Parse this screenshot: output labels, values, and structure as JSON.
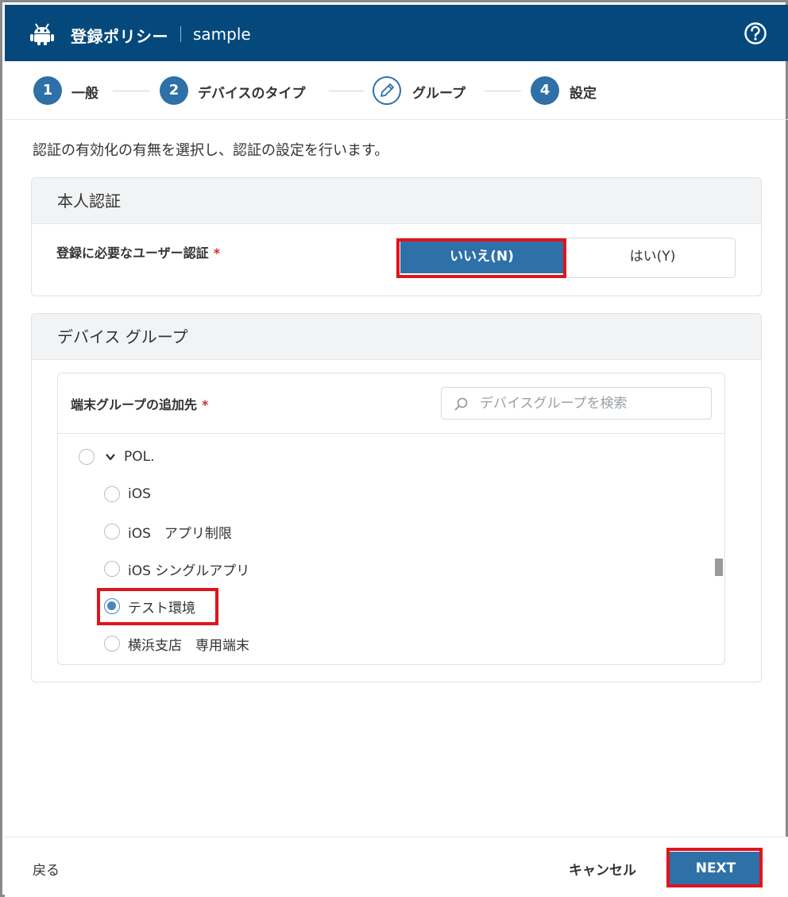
{
  "header": {
    "title": "登録ポリシー",
    "subtitle": "sample",
    "icons": {
      "app": "android-icon",
      "help": "help-icon"
    }
  },
  "steps": [
    {
      "number": "1",
      "label": "一般",
      "state": "done"
    },
    {
      "number": "2",
      "label": "デバイスのタイプ",
      "state": "done"
    },
    {
      "number": "",
      "label": "グループ",
      "state": "current",
      "icon": "pencil-icon"
    },
    {
      "number": "4",
      "label": "設定",
      "state": "pending"
    }
  ],
  "intro": "認証の有効化の有無を選択し、認証の設定を行います。",
  "auth_section": {
    "title": "本人認証",
    "field_label": "登録に必要なユーザー認証",
    "required_mark": "*",
    "options": {
      "no": "いいえ(N)",
      "yes": "はい(Y)"
    },
    "selected": "no"
  },
  "device_group_section": {
    "title": "デバイス グループ",
    "field_label": "端末グループの追加先",
    "required_mark": "*",
    "search": {
      "placeholder": "デバイスグループを検索",
      "value": ""
    },
    "tree": [
      {
        "label": "POL.",
        "level": 0,
        "expanded": true,
        "checked": false
      },
      {
        "label": "iOS",
        "level": 1,
        "checked": false
      },
      {
        "label": "iOS　アプリ制限",
        "level": 1,
        "checked": false
      },
      {
        "label": "iOS シングルアプリ",
        "level": 1,
        "checked": false
      },
      {
        "label": "テスト環境",
        "level": 1,
        "checked": true
      },
      {
        "label": "横浜支店　専用端末",
        "level": 1,
        "checked": false
      }
    ]
  },
  "footer": {
    "back": "戻る",
    "cancel": "キャンセル",
    "next": "NEXT"
  },
  "colors": {
    "header_bg": "#05497c",
    "accent": "#2e70a8",
    "highlight_box": "#e0141c",
    "required": "#d62b2b"
  }
}
